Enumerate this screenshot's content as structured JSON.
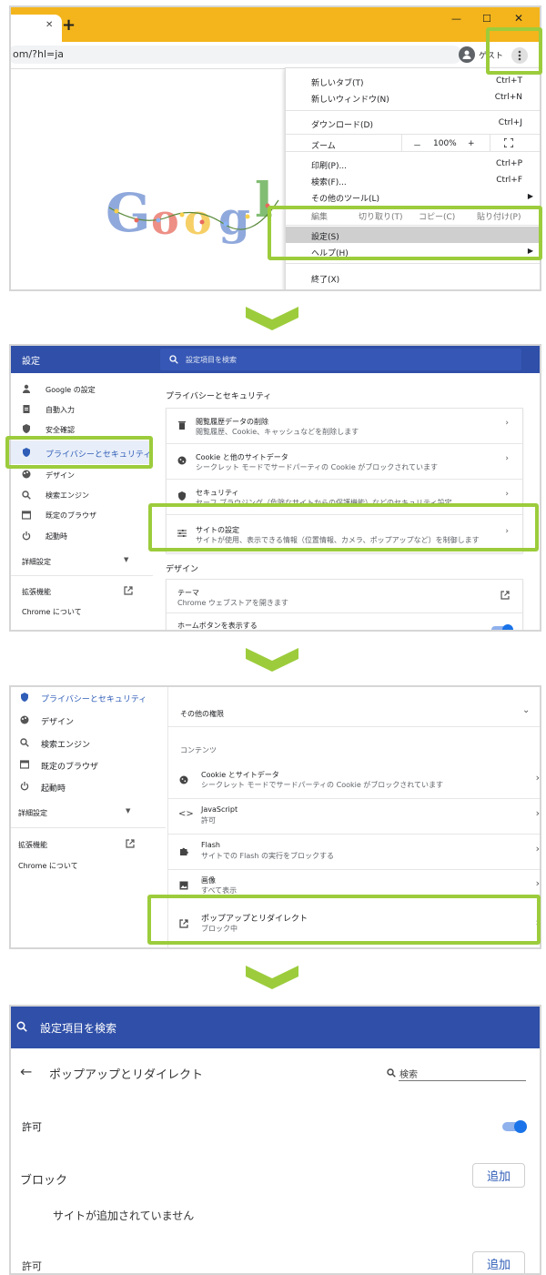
{
  "panel1": {
    "address_fragment": "om/?hl=ja",
    "new_tab_symbol": "+",
    "close_tab_symbol": "✕",
    "window_controls": {
      "minimize": "—",
      "maximize": "☐",
      "close": "✕"
    },
    "profile_label": "ゲスト",
    "doodle_letters": [
      "G",
      "o",
      "o",
      "g",
      "l",
      "e"
    ],
    "menu": {
      "new_tab": {
        "label": "新しいタブ(T)",
        "shortcut": "Ctrl+T"
      },
      "new_window": {
        "label": "新しいウィンドウ(N)",
        "shortcut": "Ctrl+N"
      },
      "downloads": {
        "label": "ダウンロード(D)",
        "shortcut": "Ctrl+J"
      },
      "zoom": {
        "label": "ズーム",
        "minus": "－",
        "value": "100%",
        "plus": "+"
      },
      "print": {
        "label": "印刷(P)...",
        "shortcut": "Ctrl+P"
      },
      "find": {
        "label": "検索(F)...",
        "shortcut": "Ctrl+F"
      },
      "more_tools": {
        "label": "その他のツール(L)"
      },
      "edit_row": {
        "label": "編集",
        "cut": "切り取り(T)",
        "copy": "コピー(C)",
        "paste": "貼り付け(P)"
      },
      "settings": {
        "label": "設定(S)"
      },
      "help": {
        "label": "ヘルプ(H)"
      },
      "exit": {
        "label": "終了(X)"
      }
    }
  },
  "panel2": {
    "header_title": "設定",
    "search_placeholder": "設定項目を検索",
    "sidebar": {
      "google": "Google の設定",
      "autofill": "自動入力",
      "safety": "安全確認",
      "privacy": "プライバシーとセキュリティ",
      "design": "デザイン",
      "search_engine": "検索エンジン",
      "default_browser": "既定のブラウザ",
      "startup": "起動時",
      "advanced": "詳細設定",
      "extensions": "拡張機能",
      "about": "Chrome について"
    },
    "section_title": "プライバシーとセキュリティ",
    "rows": [
      {
        "title": "閲覧履歴データの削除",
        "sub": "閲覧履歴、Cookie、キャッシュなどを削除します"
      },
      {
        "title": "Cookie と他のサイトデータ",
        "sub": "シークレット モードでサードパーティの Cookie がブロックされています"
      },
      {
        "title": "セキュリティ",
        "sub": "セーフ ブラウジング（危険なサイトからの保護機能）などのセキュリティ設定"
      },
      {
        "title": "サイトの設定",
        "sub": "サイトが使用、表示できる情報（位置情報、カメラ、ポップアップなど）を制御します"
      }
    ],
    "design_title": "デザイン",
    "theme": {
      "title": "テーマ",
      "sub": "Chrome ウェブストアを開きます"
    },
    "home_button": {
      "title": "ホームボタンを表示する"
    }
  },
  "panel3": {
    "sidebar": {
      "privacy": "プライバシーとセキュリティ",
      "design": "デザイン",
      "search_engine": "検索エンジン",
      "default_browser": "既定のブラウザ",
      "startup": "起動時",
      "advanced": "詳細設定",
      "extensions": "拡張機能",
      "about": "Chrome について"
    },
    "other_permissions": "その他の権限",
    "content_title": "コンテンツ",
    "rows": [
      {
        "title": "Cookie とサイトデータ",
        "sub": "シークレット モードでサードパーティの Cookie がブロックされています"
      },
      {
        "title": "JavaScript",
        "sub": "許可"
      },
      {
        "title": "Flash",
        "sub": "サイトでの Flash の実行をブロックする"
      },
      {
        "title": "画像",
        "sub": "すべて表示"
      },
      {
        "title": "ポップアップとリダイレクト",
        "sub": "ブロック中"
      }
    ]
  },
  "panel4": {
    "search_placeholder": "設定項目を検索",
    "page_title": "ポップアップとリダイレクト",
    "search_field_label": "検索",
    "allow_toggle_label": "許可",
    "allow_toggle_on": true,
    "block_title": "ブロック",
    "add_button": "追加",
    "no_sites": "サイトが追加されていません",
    "allow_title": "許可",
    "add_button2": "追加"
  },
  "colors": {
    "highlight": "#9ccc3c",
    "tab_bar": "#f3b51b",
    "settings_blue": "#2f4fa8",
    "link_blue": "#2f5db7",
    "toggle_blue": "#1a73e8"
  }
}
